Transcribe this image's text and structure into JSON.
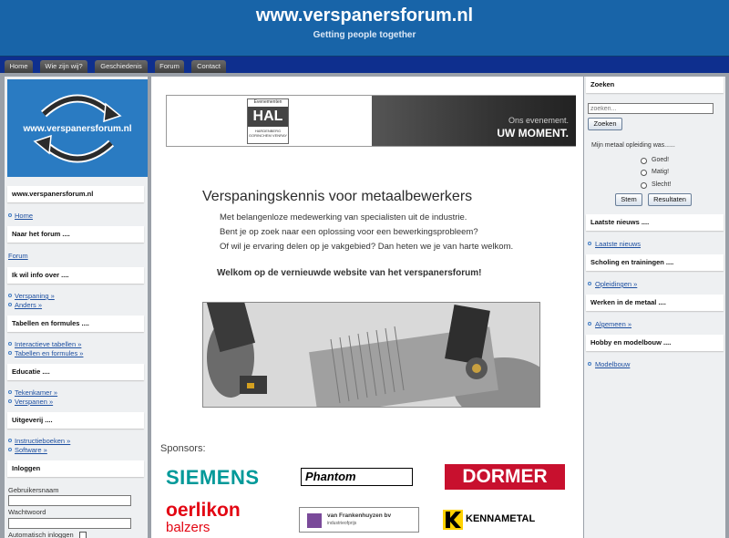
{
  "header": {
    "title": "www.verspanersforum.nl",
    "subtitle": "Getting people together"
  },
  "nav": {
    "tabs": [
      "Home",
      "Wie zijn wij?",
      "Geschiedenis",
      "Forum",
      "Contact"
    ]
  },
  "left": {
    "logo_text": "www.verspanersforum.nl",
    "site_label": "www.verspanersforum.nl",
    "home_link": "Home",
    "section_naar_forum": "Naar het forum ....",
    "forum_link": "Forum",
    "section_info": "Ik wil info over ....",
    "info_links": [
      "Verspaning »",
      "Anders »"
    ],
    "section_tabellen": "Tabellen en formules ....",
    "tabellen_links": [
      "Interactieve tabellen »",
      "Tabellen en formules »"
    ],
    "section_educatie": "Educatie ....",
    "educatie_links": [
      "Tekenkamer »",
      "Verspanen »"
    ],
    "section_uitgeverij": "Uitgeverij ....",
    "uitgeverij_links": [
      "Instructieboeken »",
      "Software »"
    ],
    "section_inloggen": "Inloggen",
    "username_label": "Gebruikersnaam",
    "password_label": "Wachtwoord",
    "auto_login_label": "Automatisch inloggen"
  },
  "center": {
    "banner": {
      "hal_top": "Evenementen",
      "hal_letters": "HAL",
      "hal_bottom": "HARDENBERG GORINCHEM VENRAY",
      "tagline": "Ons evenement.",
      "tagline_bold": "UW MOMENT."
    },
    "headline": "Verspaningskennis voor metaalbewerkers",
    "intro_lines": [
      "Met belangenloze medewerking van specialisten uit de industrie.",
      "Bent je op zoek naar een oplossing voor een bewerkingsprobleem?",
      "Of wil je ervaring delen op je vakgebied? Dan heten we je van harte welkom."
    ],
    "welcome": "Welkom op de vernieuwde website van het verspanersforum!",
    "sponsors_label": "Sponsors:",
    "sponsors": {
      "siemens": "SIEMENS",
      "phantom": "Phantom",
      "dormer": "DORMER",
      "oerlikon": "oerlikon",
      "balzers": "balzers",
      "frankenhuyzen": "van Frankenhuyzen bv",
      "frankenhuyzen_sub": "industrieofprijs",
      "kennametal": "KENNAMETAL"
    }
  },
  "right": {
    "section_zoeken": "Zoeken",
    "search_placeholder": "zoeken...",
    "search_button": "Zoeken",
    "poll_question": "Mijn metaal opleiding was......",
    "poll_options": [
      "Goed!",
      "Matig!",
      "Slecht!"
    ],
    "vote_button": "Stem",
    "results_button": "Resultaten",
    "section_nieuws": "Laatste nieuws ....",
    "nieuws_link": "Laatste nieuws",
    "section_scholing": "Scholing en trainingen ....",
    "scholing_link": "Opleidingen »",
    "section_werken": "Werken in de metaal ....",
    "werken_link": "Algemeen »",
    "section_hobby": "Hobby en modelbouw ....",
    "hobby_link": "Modelbouw"
  },
  "colors": {
    "header_blue": "#1864a8",
    "tabbar_navy": "#0e2f8e",
    "link_blue": "#1d4fa0",
    "siemens_teal": "#009999",
    "dormer_red": "#c8102e",
    "oerlikon_red": "#e30613",
    "kennametal_yellow": "#ffd200"
  },
  "icons": [
    "refresh-arrows-icon",
    "bullet-icon"
  ]
}
